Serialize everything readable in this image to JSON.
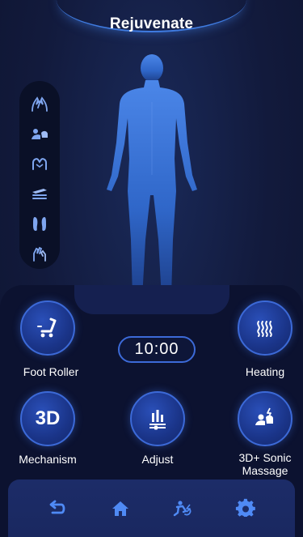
{
  "header": {
    "title": "Rejuvenate"
  },
  "side_modes": [
    {
      "icon": "hands-kneading-icon"
    },
    {
      "icon": "shoulder-press-icon"
    },
    {
      "icon": "hands-grip-icon"
    },
    {
      "icon": "back-roller-icon"
    },
    {
      "icon": "feet-icon"
    },
    {
      "icon": "hand-tap-icon"
    }
  ],
  "timer": {
    "value": "10:00"
  },
  "controls": {
    "foot_roller": "Foot Roller",
    "heating": "Heating",
    "mechanism": "Mechanism",
    "mechanism_icon_text": "3D",
    "adjust": "Adjust",
    "sonic_massage": "3D+ Sonic\nMassage"
  },
  "nav": [
    {
      "icon": "back-icon"
    },
    {
      "icon": "home-icon"
    },
    {
      "icon": "massage-mode-icon"
    },
    {
      "icon": "settings-icon"
    }
  ],
  "colors": {
    "accent": "#3c6ad8",
    "background": "#0f1632",
    "button": "#1a3488"
  }
}
